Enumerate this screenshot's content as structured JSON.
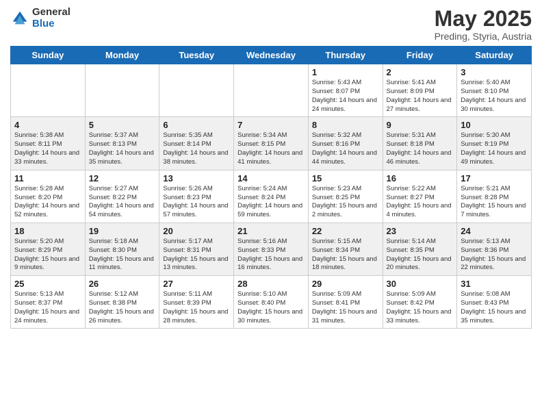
{
  "header": {
    "logo_general": "General",
    "logo_blue": "Blue",
    "title": "May 2025",
    "subtitle": "Preding, Styria, Austria"
  },
  "days_of_week": [
    "Sunday",
    "Monday",
    "Tuesday",
    "Wednesday",
    "Thursday",
    "Friday",
    "Saturday"
  ],
  "weeks": [
    [
      {
        "day": "",
        "info": ""
      },
      {
        "day": "",
        "info": ""
      },
      {
        "day": "",
        "info": ""
      },
      {
        "day": "",
        "info": ""
      },
      {
        "day": "1",
        "info": "Sunrise: 5:43 AM\nSunset: 8:07 PM\nDaylight: 14 hours\nand 24 minutes."
      },
      {
        "day": "2",
        "info": "Sunrise: 5:41 AM\nSunset: 8:09 PM\nDaylight: 14 hours\nand 27 minutes."
      },
      {
        "day": "3",
        "info": "Sunrise: 5:40 AM\nSunset: 8:10 PM\nDaylight: 14 hours\nand 30 minutes."
      }
    ],
    [
      {
        "day": "4",
        "info": "Sunrise: 5:38 AM\nSunset: 8:11 PM\nDaylight: 14 hours\nand 33 minutes."
      },
      {
        "day": "5",
        "info": "Sunrise: 5:37 AM\nSunset: 8:13 PM\nDaylight: 14 hours\nand 35 minutes."
      },
      {
        "day": "6",
        "info": "Sunrise: 5:35 AM\nSunset: 8:14 PM\nDaylight: 14 hours\nand 38 minutes."
      },
      {
        "day": "7",
        "info": "Sunrise: 5:34 AM\nSunset: 8:15 PM\nDaylight: 14 hours\nand 41 minutes."
      },
      {
        "day": "8",
        "info": "Sunrise: 5:32 AM\nSunset: 8:16 PM\nDaylight: 14 hours\nand 44 minutes."
      },
      {
        "day": "9",
        "info": "Sunrise: 5:31 AM\nSunset: 8:18 PM\nDaylight: 14 hours\nand 46 minutes."
      },
      {
        "day": "10",
        "info": "Sunrise: 5:30 AM\nSunset: 8:19 PM\nDaylight: 14 hours\nand 49 minutes."
      }
    ],
    [
      {
        "day": "11",
        "info": "Sunrise: 5:28 AM\nSunset: 8:20 PM\nDaylight: 14 hours\nand 52 minutes."
      },
      {
        "day": "12",
        "info": "Sunrise: 5:27 AM\nSunset: 8:22 PM\nDaylight: 14 hours\nand 54 minutes."
      },
      {
        "day": "13",
        "info": "Sunrise: 5:26 AM\nSunset: 8:23 PM\nDaylight: 14 hours\nand 57 minutes."
      },
      {
        "day": "14",
        "info": "Sunrise: 5:24 AM\nSunset: 8:24 PM\nDaylight: 14 hours\nand 59 minutes."
      },
      {
        "day": "15",
        "info": "Sunrise: 5:23 AM\nSunset: 8:25 PM\nDaylight: 15 hours\nand 2 minutes."
      },
      {
        "day": "16",
        "info": "Sunrise: 5:22 AM\nSunset: 8:27 PM\nDaylight: 15 hours\nand 4 minutes."
      },
      {
        "day": "17",
        "info": "Sunrise: 5:21 AM\nSunset: 8:28 PM\nDaylight: 15 hours\nand 7 minutes."
      }
    ],
    [
      {
        "day": "18",
        "info": "Sunrise: 5:20 AM\nSunset: 8:29 PM\nDaylight: 15 hours\nand 9 minutes."
      },
      {
        "day": "19",
        "info": "Sunrise: 5:18 AM\nSunset: 8:30 PM\nDaylight: 15 hours\nand 11 minutes."
      },
      {
        "day": "20",
        "info": "Sunrise: 5:17 AM\nSunset: 8:31 PM\nDaylight: 15 hours\nand 13 minutes."
      },
      {
        "day": "21",
        "info": "Sunrise: 5:16 AM\nSunset: 8:33 PM\nDaylight: 15 hours\nand 16 minutes."
      },
      {
        "day": "22",
        "info": "Sunrise: 5:15 AM\nSunset: 8:34 PM\nDaylight: 15 hours\nand 18 minutes."
      },
      {
        "day": "23",
        "info": "Sunrise: 5:14 AM\nSunset: 8:35 PM\nDaylight: 15 hours\nand 20 minutes."
      },
      {
        "day": "24",
        "info": "Sunrise: 5:13 AM\nSunset: 8:36 PM\nDaylight: 15 hours\nand 22 minutes."
      }
    ],
    [
      {
        "day": "25",
        "info": "Sunrise: 5:13 AM\nSunset: 8:37 PM\nDaylight: 15 hours\nand 24 minutes."
      },
      {
        "day": "26",
        "info": "Sunrise: 5:12 AM\nSunset: 8:38 PM\nDaylight: 15 hours\nand 26 minutes."
      },
      {
        "day": "27",
        "info": "Sunrise: 5:11 AM\nSunset: 8:39 PM\nDaylight: 15 hours\nand 28 minutes."
      },
      {
        "day": "28",
        "info": "Sunrise: 5:10 AM\nSunset: 8:40 PM\nDaylight: 15 hours\nand 30 minutes."
      },
      {
        "day": "29",
        "info": "Sunrise: 5:09 AM\nSunset: 8:41 PM\nDaylight: 15 hours\nand 31 minutes."
      },
      {
        "day": "30",
        "info": "Sunrise: 5:09 AM\nSunset: 8:42 PM\nDaylight: 15 hours\nand 33 minutes."
      },
      {
        "day": "31",
        "info": "Sunrise: 5:08 AM\nSunset: 8:43 PM\nDaylight: 15 hours\nand 35 minutes."
      }
    ]
  ]
}
